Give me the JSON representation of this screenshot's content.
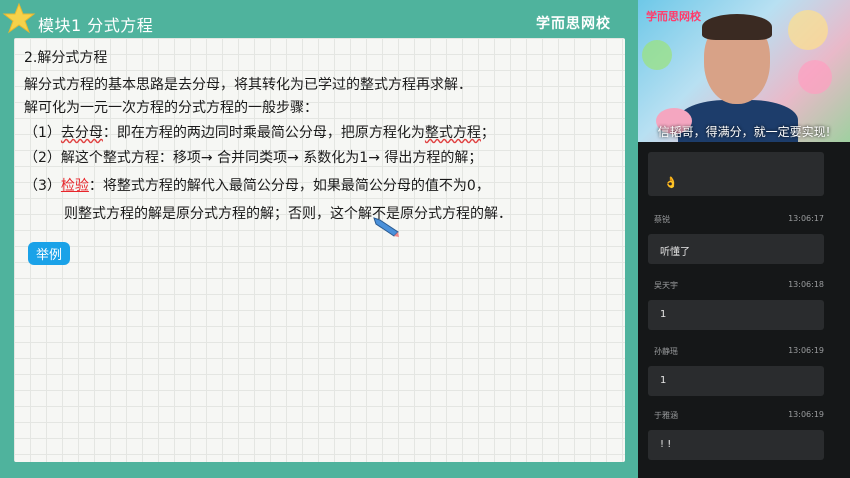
{
  "slide": {
    "title": "模块1  分式方程",
    "brand": "学而思网校",
    "heading": "2.解分式方程",
    "p1": "解分式方程的基本思路是去分母，将其转化为已学过的整式方程再求解．",
    "p2": "解可化为一元一次方程的分式方程的一般步骤：",
    "step1_num": "（1）",
    "step1_key": "去分母",
    "step1_text": "：即在方程的两边同时乘最简公分母，把原方程化为",
    "step1_key2": "整式方程",
    "step1_end": "；",
    "step2_num": "（2）",
    "step2_text": "解这个整式方程：移项→ 合并同类项→ 系数化为1→ 得出方程的解；",
    "step3_num": "（3）",
    "step3_key": "检验",
    "step3_text": "：将整式方程的解代入最简公分母，如果最简公分母的值不为0，",
    "step3_line2": "则整式方程的解是原分式方程的解；否则，这个解不是原分式方程的解．",
    "example": "举例"
  },
  "video": {
    "logo": "学而思网校",
    "caption": "信韬哥，得满分，就一定要实现!"
  },
  "chat": {
    "top_emoji": "👌",
    "messages": [
      {
        "name": "蔡锐",
        "time": "13:06:17",
        "text": "听懂了"
      },
      {
        "name": "吴天宇",
        "time": "13:06:18",
        "text": "1"
      },
      {
        "name": "孙静瑶",
        "time": "13:06:19",
        "text": "1"
      },
      {
        "name": "于雅涵",
        "time": "13:06:19",
        "text": "! !"
      }
    ]
  }
}
